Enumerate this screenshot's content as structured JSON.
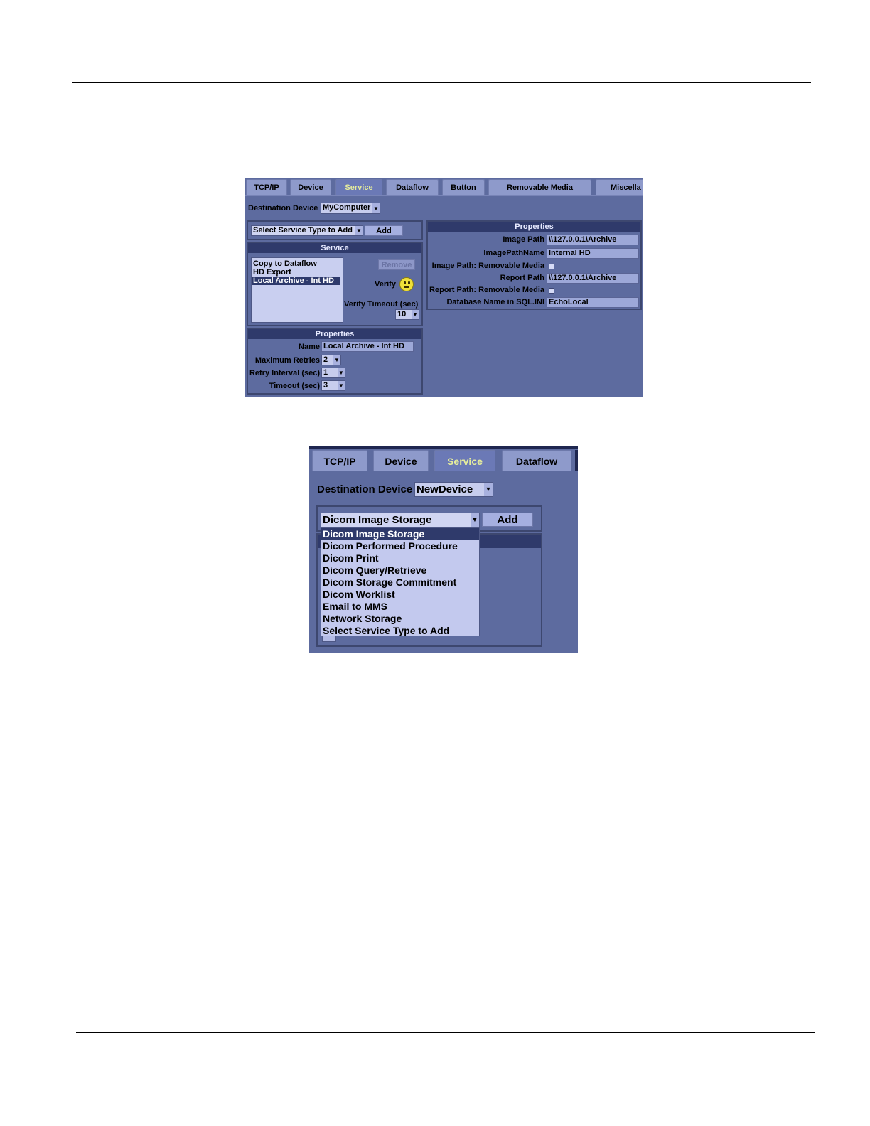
{
  "screenshot1": {
    "tabs": [
      "TCP/IP",
      "Device",
      "Service",
      "Dataflow",
      "Button",
      "Removable Media",
      "Miscella"
    ],
    "active_tab": "Service",
    "destination_device_label": "Destination Device",
    "destination_device_value": "MyComputer",
    "service_type_select": "Select Service Type to Add",
    "add_label": "Add",
    "service_header": "Service",
    "services": [
      "Copy to Dataflow",
      "HD Export",
      "Local Archive - Int HD"
    ],
    "selected_service": "Local Archive - Int HD",
    "remove_label": "Remove",
    "verify_label": "Verify",
    "verify_timeout_label": "Verify Timeout (sec)",
    "verify_timeout_value": "10",
    "left_properties": {
      "header": "Properties",
      "name_label": "Name",
      "name_value": "Local Archive - Int HD",
      "max_retries_label": "Maximum Retries",
      "max_retries_value": "2",
      "retry_interval_label": "Retry Interval (sec)",
      "retry_interval_value": "1",
      "timeout_label": "Timeout (sec)",
      "timeout_value": "3"
    },
    "right_properties": {
      "header": "Properties",
      "image_path_label": "Image Path",
      "image_path_value": "\\\\127.0.0.1\\Archive",
      "image_path_name_label": "ImagePathName",
      "image_path_name_value": "Internal HD",
      "image_path_removable_label": "Image Path: Removable Media",
      "report_path_label": "Report Path",
      "report_path_value": "\\\\127.0.0.1\\Archive",
      "report_path_removable_label": "Report Path: Removable Media",
      "db_name_label": "Database Name in SQL.INI",
      "db_name_value": "EchoLocal"
    }
  },
  "screenshot2": {
    "tabs": [
      "TCP/IP",
      "Device",
      "Service",
      "Dataflow"
    ],
    "active_tab": "Service",
    "destination_device_label": "Destination Device",
    "destination_device_value": "NewDevice",
    "service_type_select": "Dicom Image Storage",
    "add_label": "Add",
    "dropdown_options": [
      "Dicom Image Storage",
      "Dicom Performed Procedure",
      "Dicom Print",
      "Dicom Query/Retrieve",
      "Dicom Storage Commitment",
      "Dicom Worklist",
      "Email to MMS",
      "Network Storage",
      "Select Service Type to Add"
    ],
    "highlighted_option": "Dicom Image Storage"
  },
  "icons": {
    "dropdown_arrow": "chevron-down-icon",
    "verify_status": "neutral-face-icon",
    "checkbox": "checkbox-icon"
  },
  "colors": {
    "panel_bg": "#5d6b9f",
    "header_bg": "#2f3a6b",
    "active_tab_text": "#e6ed9c",
    "selected_item_bg": "#2e3a6c"
  }
}
